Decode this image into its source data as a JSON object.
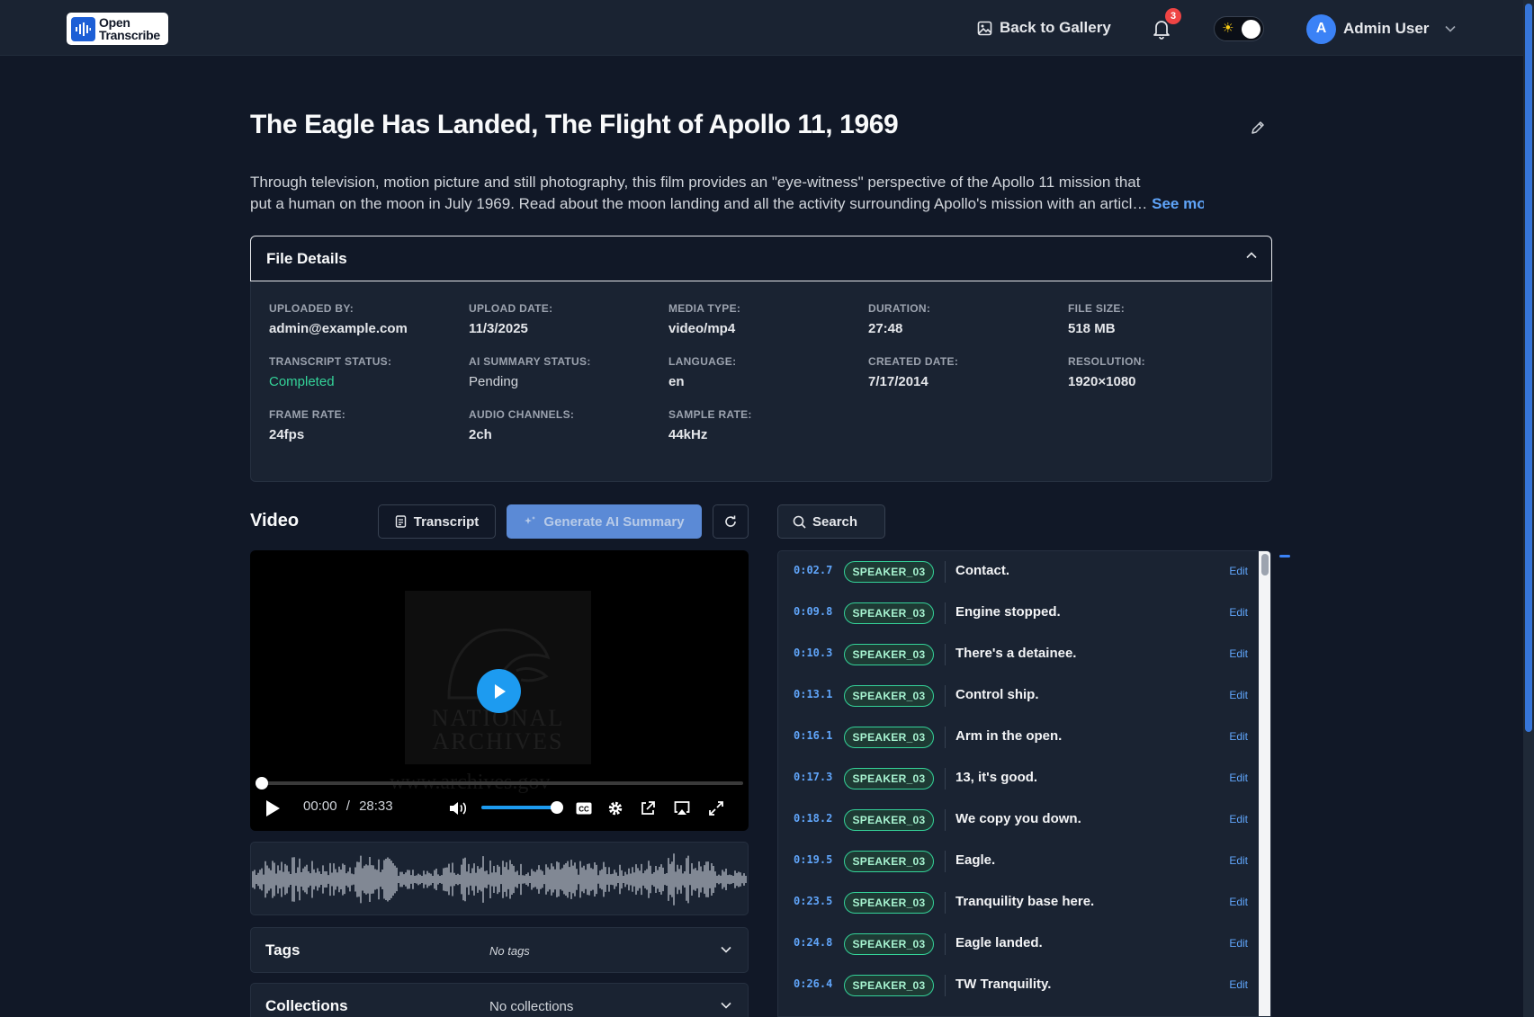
{
  "header": {
    "logo_line1": "Open",
    "logo_line2": "Transcribe",
    "back_label": "Back to Gallery",
    "notification_count": "3",
    "user_initial": "A",
    "user_name": "Admin User"
  },
  "page": {
    "title": "The Eagle Has Landed, The Flight of Apollo 11, 1969",
    "description_line1": "Through television, motion picture and still photography, this film provides an \"eye-witness\" perspective of the Apollo 11 mission that",
    "description_line2": "put a human on the moon in July 1969. Read about the moon landing and all the activity surrounding Apollo's mission with an articl…",
    "see_more": "See more"
  },
  "file_details": {
    "heading": "File Details",
    "items": [
      {
        "label": "UPLOADED BY:",
        "value": "admin@example.com"
      },
      {
        "label": "UPLOAD DATE:",
        "value": "11/3/2025"
      },
      {
        "label": "MEDIA TYPE:",
        "value": "video/mp4"
      },
      {
        "label": "DURATION:",
        "value": "27:48"
      },
      {
        "label": "FILE SIZE:",
        "value": "518 MB"
      },
      {
        "label": "TRANSCRIPT STATUS:",
        "value": "Completed"
      },
      {
        "label": "AI SUMMARY STATUS:",
        "value": "Pending"
      },
      {
        "label": "LANGUAGE:",
        "value": "en"
      },
      {
        "label": "CREATED DATE:",
        "value": "7/17/2014"
      },
      {
        "label": "RESOLUTION:",
        "value": "1920×1080"
      },
      {
        "label": "FRAME RATE:",
        "value": "24fps"
      },
      {
        "label": "AUDIO CHANNELS:",
        "value": "2ch"
      },
      {
        "label": "SAMPLE RATE:",
        "value": "44kHz"
      }
    ]
  },
  "toolbar": {
    "video_label": "Video",
    "transcript_button": "Transcript",
    "ai_summary_button": "Generate AI Summary",
    "search_label": "Search"
  },
  "player": {
    "poster_line1": "NATIONAL",
    "poster_line2": "ARCHIVES",
    "watermark": "www.archives.gov",
    "current_time": "00:00",
    "time_separator": "/",
    "total_time": "28:33",
    "progress_fraction": 0,
    "volume_fraction": 1
  },
  "tags": {
    "title": "Tags",
    "value": "No tags"
  },
  "collections": {
    "title": "Collections",
    "value": "No collections"
  },
  "transcript": {
    "edit_label": "Edit",
    "segments": [
      {
        "time": "0:02.7",
        "speaker": "SPEAKER_03",
        "text": "Contact."
      },
      {
        "time": "0:09.8",
        "speaker": "SPEAKER_03",
        "text": "Engine stopped."
      },
      {
        "time": "0:10.3",
        "speaker": "SPEAKER_03",
        "text": "There's a detainee."
      },
      {
        "time": "0:13.1",
        "speaker": "SPEAKER_03",
        "text": "Control ship."
      },
      {
        "time": "0:16.1",
        "speaker": "SPEAKER_03",
        "text": "Arm in the open."
      },
      {
        "time": "0:17.3",
        "speaker": "SPEAKER_03",
        "text": "13, it's good."
      },
      {
        "time": "0:18.2",
        "speaker": "SPEAKER_03",
        "text": "We copy you down."
      },
      {
        "time": "0:19.5",
        "speaker": "SPEAKER_03",
        "text": "Eagle."
      },
      {
        "time": "0:23.5",
        "speaker": "SPEAKER_03",
        "text": "Tranquility base here."
      },
      {
        "time": "0:24.8",
        "speaker": "SPEAKER_03",
        "text": "Eagle landed."
      },
      {
        "time": "0:26.4",
        "speaker": "SPEAKER_03",
        "text": "TW Tranquility."
      }
    ]
  }
}
